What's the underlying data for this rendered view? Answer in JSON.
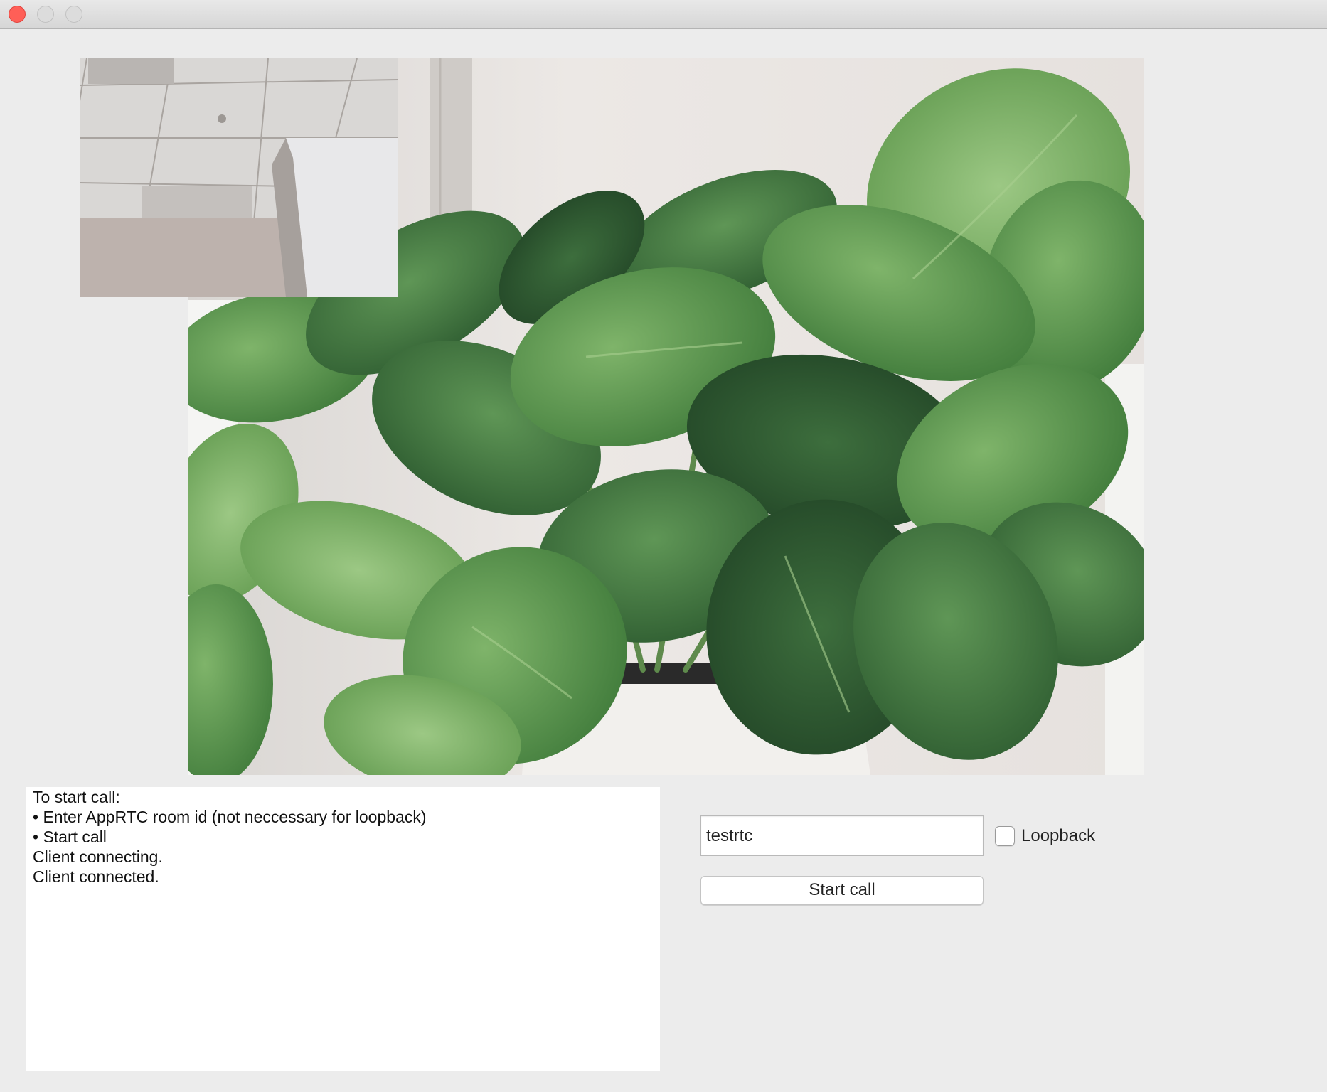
{
  "window": {
    "controls": [
      "close-button",
      "minimize-button",
      "zoom-button"
    ]
  },
  "log": {
    "lines": [
      "To start call:",
      "• Enter AppRTC room id (not neccessary for loopback)",
      "• Start call",
      "Client connecting.",
      "Client connected."
    ]
  },
  "controls": {
    "room_id_value": "testrtc",
    "loopback_label": "Loopback",
    "loopback_checked": false,
    "start_call_label": "Start call"
  },
  "colors": {
    "window_background": "#ececec",
    "close_button": "#ff5f57",
    "log_background": "#ffffff"
  }
}
